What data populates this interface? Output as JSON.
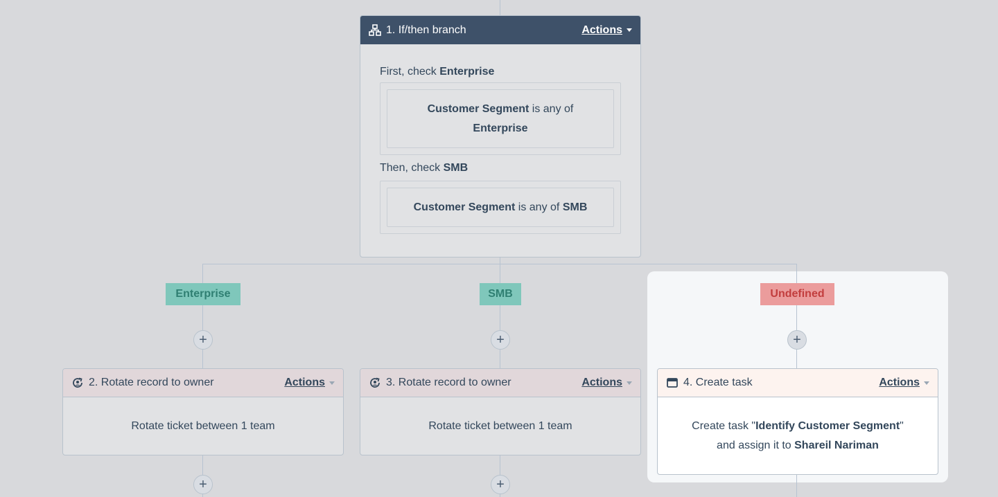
{
  "branch_card": {
    "title": "1. If/then branch",
    "actions_label": "Actions",
    "first_prefix": "First, check",
    "first_name": "Enterprise",
    "first_condition": {
      "property": "Customer Segment",
      "operator": "is any of",
      "value": "Enterprise"
    },
    "then_prefix": "Then, check",
    "then_name": "SMB",
    "then_condition": {
      "property": "Customer Segment",
      "operator": "is any of",
      "value": "SMB"
    }
  },
  "branches": {
    "enterprise_label": "Enterprise",
    "smb_label": "SMB",
    "undefined_label": "Undefined"
  },
  "add_step_symbol": "+",
  "rotate_card_1": {
    "title": "2. Rotate record to owner",
    "actions_label": "Actions",
    "body": "Rotate ticket between 1 team"
  },
  "rotate_card_2": {
    "title": "3. Rotate record to owner",
    "actions_label": "Actions",
    "body": "Rotate ticket between 1 team"
  },
  "task_card": {
    "title": "4. Create task",
    "actions_label": "Actions",
    "line1_prefix": "Create task \"",
    "task_name": "Identify Customer Segment",
    "line1_suffix": "\"",
    "line2_prefix": "and assign it to",
    "assignee": "Shareil Nariman"
  },
  "colors": {
    "canvas_bg": "#d8d9dc",
    "header_dark": "#3e5169",
    "tag_green": "#7fc7bb",
    "tag_red": "#eb9c9c",
    "connector": "#b7c3d1"
  },
  "icons": {
    "branch": "branch-icon",
    "rotate": "rotate-owner-icon",
    "task": "task-icon"
  }
}
